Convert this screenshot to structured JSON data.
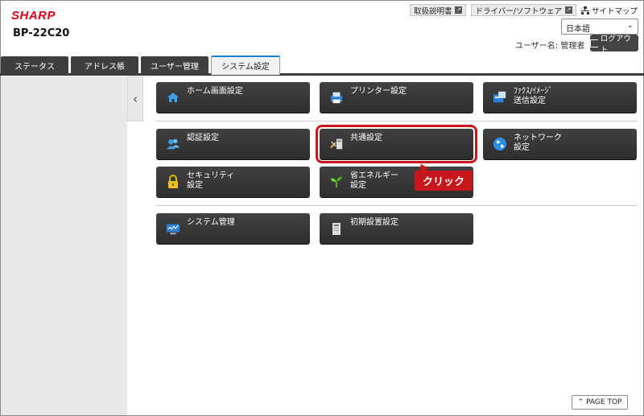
{
  "brand": {
    "logo": "SHARP",
    "model": "BP-22C20"
  },
  "toplinks": {
    "manual": "取扱説明書",
    "driver": "ドライバー/ソフトウェア",
    "sitemap": "サイトマップ"
  },
  "language": {
    "selected": "日本語"
  },
  "user": {
    "label": "ユーザー名: 管理者",
    "logout": "ログアウト"
  },
  "tabs": [
    {
      "label": "ステータス",
      "active": false
    },
    {
      "label": "アドレス帳",
      "active": false
    },
    {
      "label": "ユーザー管理",
      "active": false
    },
    {
      "label": "システム設定",
      "active": true
    }
  ],
  "buttons": [
    {
      "label": "ホーム画面設定",
      "icon": "home-icon"
    },
    {
      "label": "プリンター設定",
      "icon": "printer-icon"
    },
    {
      "label": "ﾌｧｸｽ/ｲﾒｰｼﾞ\n送信設定",
      "icon": "fax-icon"
    },
    {
      "label": "認証設定",
      "icon": "users-icon"
    },
    {
      "label": "共通設定",
      "icon": "tools-icon"
    },
    {
      "label": "ネットワーク\n設定",
      "icon": "globe-icon"
    },
    {
      "label": "セキュリティ\n設定",
      "icon": "lock-icon"
    },
    {
      "label": "省エネルギー\n設定",
      "icon": "leaf-icon"
    },
    {
      "label": "システム管理",
      "icon": "monitor-icon"
    },
    {
      "label": "初期設置設定",
      "icon": "device-icon"
    }
  ],
  "callout": "クリック",
  "pagetop": "PAGE TOP",
  "colors": {
    "accent": "#c8161d",
    "button": "#333333",
    "tab_active_line": "#0a84d6"
  }
}
